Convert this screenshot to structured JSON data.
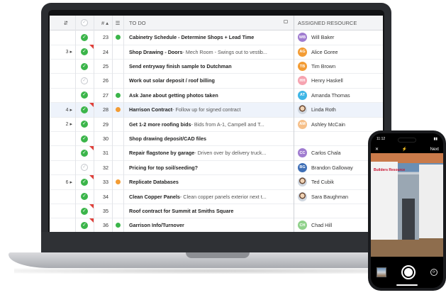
{
  "grid": {
    "header": {
      "num_label": "#",
      "task_label": "TO DO",
      "resource_label": "ASSIGNED RESOURCE"
    },
    "rows": [
      {
        "ind": "",
        "checked": true,
        "flag": false,
        "num": "23",
        "dot": "#3bb54a",
        "title": "Cabinetry Schedule - Determine Shops + Lead Time",
        "detail": "",
        "res_initials": "WB",
        "res_color": "#a07cd0",
        "res_name": "Will Baker",
        "photo": false,
        "selected": false
      },
      {
        "ind": "3 ▸",
        "checked": true,
        "flag": true,
        "num": "24",
        "dot": "",
        "title": "Shop Drawing - Doors",
        "detail": " - Mech Room - Swings out to vestib...",
        "res_initials": "AG",
        "res_color": "#f39c34",
        "res_name": "Alice Goree",
        "photo": false,
        "selected": false
      },
      {
        "ind": "",
        "checked": true,
        "flag": false,
        "num": "25",
        "dot": "",
        "title": "Send entryway finish sample to Dutchman",
        "detail": "",
        "res_initials": "TB",
        "res_color": "#f39c34",
        "res_name": "Tim Brown",
        "photo": false,
        "selected": false
      },
      {
        "ind": "",
        "checked": false,
        "flag": false,
        "num": "26",
        "dot": "",
        "title": "Work out solar deposit / roof billing",
        "detail": "",
        "res_initials": "HH",
        "res_color": "#f6a3b0",
        "res_name": "Henry Haskell",
        "photo": false,
        "selected": false
      },
      {
        "ind": "",
        "checked": true,
        "flag": false,
        "num": "27",
        "dot": "#3bb54a",
        "title": "Ask Jane about getting photos taken",
        "detail": "",
        "res_initials": "AT",
        "res_color": "#3fb6e6",
        "res_name": "Amanda Thomas",
        "photo": false,
        "selected": false
      },
      {
        "ind": "4 ▸",
        "checked": true,
        "flag": true,
        "num": "28",
        "dot": "#f39c34",
        "title": "Harrison Contract",
        "detail": " - Follow up for signed contract",
        "res_initials": "",
        "res_color": "",
        "res_name": "Linda Roth",
        "photo": true,
        "selected": true
      },
      {
        "ind": "2 ▸",
        "checked": true,
        "flag": false,
        "num": "29",
        "dot": "",
        "title": "Get 1-2 more roofing bids",
        "detail": " - Bids from A-1, Campell and T...",
        "res_initials": "AM",
        "res_color": "#f6c08a",
        "res_name": "Ashley McCain",
        "photo": false,
        "selected": false
      },
      {
        "ind": "",
        "checked": true,
        "flag": false,
        "num": "30",
        "dot": "",
        "title": "Shop drawing deposit/CAD files",
        "detail": "",
        "res_initials": "",
        "res_color": "",
        "res_name": "",
        "photo": false,
        "selected": false
      },
      {
        "ind": "",
        "checked": true,
        "flag": true,
        "num": "31",
        "dot": "",
        "title": "Repair flagstone by garage",
        "detail": " - Driven over by delivery truck...",
        "res_initials": "CC",
        "res_color": "#a07cd0",
        "res_name": "Carlos Chala",
        "photo": false,
        "selected": false
      },
      {
        "ind": "",
        "checked": false,
        "flag": false,
        "num": "32",
        "dot": "",
        "title": "Pricing for top soil/seeding?",
        "detail": "",
        "res_initials": "BG",
        "res_color": "#3f6fb6",
        "res_name": "Brandon Galloway",
        "photo": false,
        "selected": false
      },
      {
        "ind": "6 ▸",
        "checked": true,
        "flag": true,
        "num": "33",
        "dot": "#f39c34",
        "title": "Replicate Databases",
        "detail": "",
        "res_initials": "",
        "res_color": "",
        "res_name": "Ted Cubik",
        "photo": true,
        "selected": false
      },
      {
        "ind": "",
        "checked": true,
        "flag": false,
        "num": "34",
        "dot": "",
        "title": "Clean Copper Panels",
        "detail": " - Clean copper panels exterior next t...",
        "res_initials": "",
        "res_color": "",
        "res_name": "Sara Baughman",
        "photo": true,
        "selected": false
      },
      {
        "ind": "",
        "checked": true,
        "flag": true,
        "num": "35",
        "dot": "",
        "title": "Roof contract for Summit at Smiths Square",
        "detail": "",
        "res_initials": "",
        "res_color": "",
        "res_name": "",
        "photo": false,
        "selected": false
      },
      {
        "ind": "",
        "checked": true,
        "flag": true,
        "num": "36",
        "dot": "#3bb54a",
        "title": "Garrison Info/Turnover",
        "detail": "",
        "res_initials": "CH",
        "res_color": "#8fd18a",
        "res_name": "Chad Hill",
        "photo": false,
        "selected": false
      }
    ]
  },
  "phone": {
    "time": "11:12",
    "close_label": "✕",
    "flash_label": "⚡",
    "next_label": "Next",
    "sign_text": "Builders Resource"
  }
}
